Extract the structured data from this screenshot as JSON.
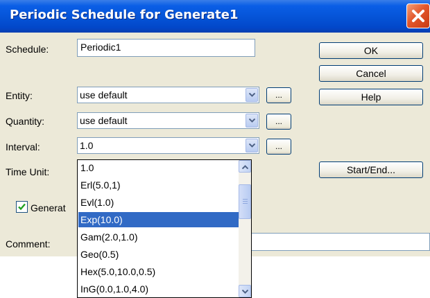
{
  "window": {
    "title": "Periodic Schedule for Generate1"
  },
  "form": {
    "schedule_label": "Schedule:",
    "schedule_value": "Periodic1",
    "entity_label": "Entity:",
    "entity_value": "use default",
    "quantity_label": "Quantity:",
    "quantity_value": "use default",
    "interval_label": "Interval:",
    "interval_value": "1.0",
    "time_unit_label": "Time Unit:",
    "generate_label": "Generat",
    "generate_checked": true,
    "comment_label": "Comment:",
    "ellipsis": "..."
  },
  "buttons": {
    "ok": "OK",
    "cancel": "Cancel",
    "help": "Help",
    "start_end": "Start/End..."
  },
  "dropdown": {
    "items": [
      "1.0",
      "Erl(5.0,1)",
      "Evl(1.0)",
      "Exp(10.0)",
      "Gam(2.0,1.0)",
      "Geo(0.5)",
      "Hex(5.0,10.0,0.5)",
      "InG(0.0,1.0,4.0)"
    ],
    "selected_index": 3
  },
  "colors": {
    "selection": "#316ac5",
    "title_bar": "#0553d6",
    "dialog_bg": "#ece9d8",
    "close_button": "#e2572c"
  }
}
